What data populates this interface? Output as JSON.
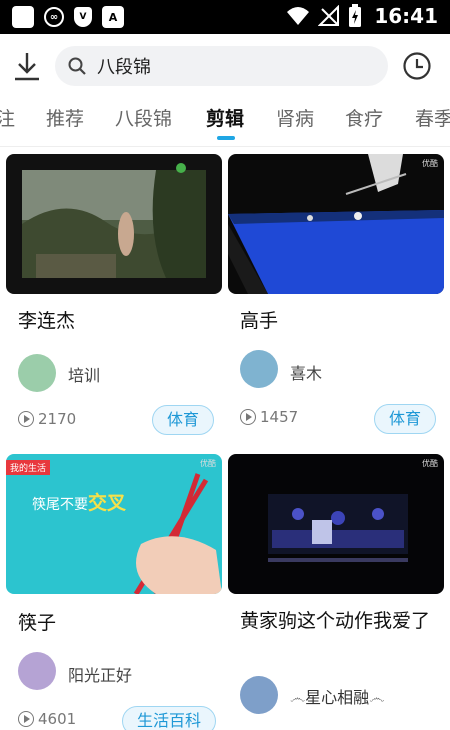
{
  "status_bar": {
    "time": "16:41",
    "left_icons": [
      "square-icon",
      "infinity-icon",
      "shield-v-icon",
      "a-box-icon"
    ],
    "right_icons": [
      "wifi-icon",
      "no-signal-icon",
      "battery-charging-icon"
    ],
    "infinity_glyph": "∞",
    "shield_glyph": "V",
    "a_glyph": "A"
  },
  "search": {
    "query": "八段锦"
  },
  "tabs": [
    "注",
    "推荐",
    "八段锦",
    "剪辑",
    "肾病",
    "食疗",
    "春季"
  ],
  "active_tab": "剪辑",
  "accent_color": "#1fa6e4",
  "cards": [
    {
      "title": "李连杰",
      "author": "培训",
      "avatar_color": "#9bcdaa",
      "views": "2170",
      "tag": "体育",
      "thumb_theme": "jungle-scene"
    },
    {
      "title": "高手",
      "author": "喜木",
      "avatar_color": "#7fb3d0",
      "views": "1457",
      "tag": "体育",
      "thumb_theme": "billiards-table",
      "watermark": "优酷"
    },
    {
      "title": "筷子",
      "author": "阳光正好",
      "avatar_color": "#b5a3d4",
      "views": "4601",
      "tag": "生活百科",
      "thumb_theme": "chopsticks-cyan",
      "thumb_badge": "我的生活",
      "thumb_caption_a": "筷尾不要",
      "thumb_caption_b": "交叉",
      "watermark": "优酷"
    },
    {
      "title": "黄家驹这个动作我爱了",
      "author": "星心相融",
      "avatar_color": "#7e9fc9",
      "views": "",
      "tag": "",
      "thumb_theme": "concert-stage",
      "watermark": "优酷"
    }
  ]
}
